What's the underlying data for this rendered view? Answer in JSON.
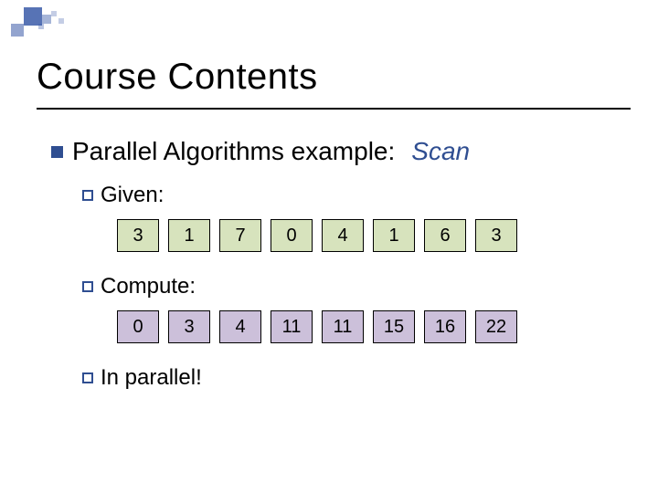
{
  "title": "Course Contents",
  "bullet": {
    "text": "Parallel Algorithms example:",
    "emph": "Scan"
  },
  "given": {
    "label": "Given:",
    "values": [
      "3",
      "1",
      "7",
      "0",
      "4",
      "1",
      "6",
      "3"
    ]
  },
  "compute": {
    "label": "Compute:",
    "values": [
      "0",
      "3",
      "4",
      "11",
      "11",
      "15",
      "16",
      "22"
    ]
  },
  "footer": {
    "prefix": "In",
    "rest": " parallel!"
  },
  "colors": {
    "accent": "#2f4e91",
    "given_bg": "#d7e3bd",
    "compute_bg": "#ccc0da"
  }
}
